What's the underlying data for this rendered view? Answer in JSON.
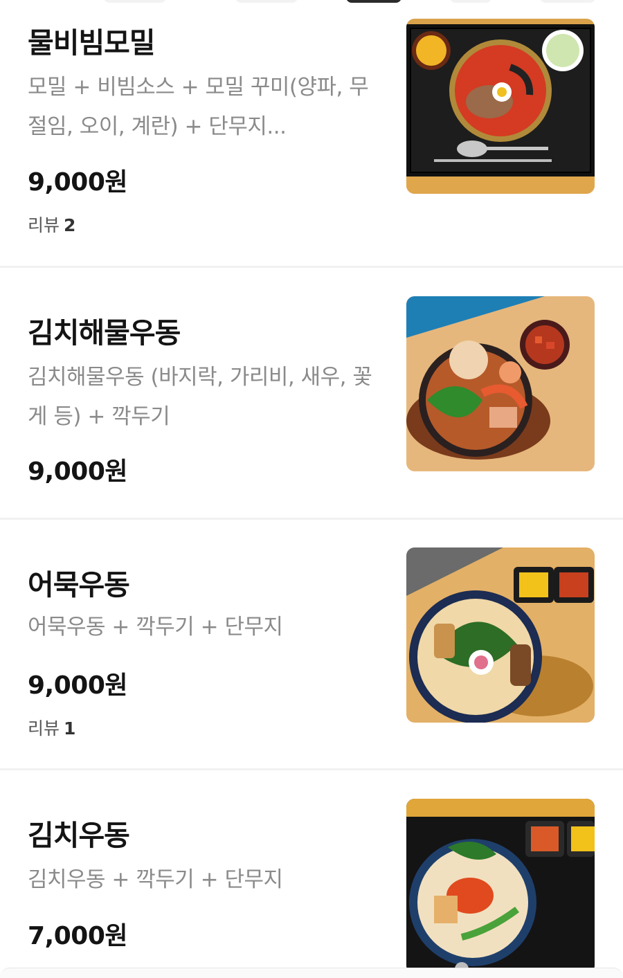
{
  "menu": {
    "items": [
      {
        "name": "물비빔모밀",
        "description": "모밀 + 비빔소스 + 모밀 꾸미(양파, 무절임, 오이, 계란) + 단무지...",
        "price": "9,000원",
        "review_label": "리뷰",
        "review_count": "2"
      },
      {
        "name": "김치해물우동",
        "description": "김치해물우동 (바지락, 가리비, 새우, 꽃게 등) + 깍두기",
        "price": "9,000원"
      },
      {
        "name": "어묵우동",
        "description": "어묵우동 + 깍두기 + 단무지",
        "price": "9,000원",
        "review_label": "리뷰",
        "review_count": "1"
      },
      {
        "name": "김치우동",
        "description": "김치우동 + 깍두기 + 단무지",
        "price": "7,000원"
      }
    ]
  },
  "images": [
    {
      "icon": "naengmyeon-photo"
    },
    {
      "icon": "kimchi-seafood-udon-photo"
    },
    {
      "icon": "fishcake-udon-photo"
    },
    {
      "icon": "kimchi-udon-photo"
    }
  ]
}
